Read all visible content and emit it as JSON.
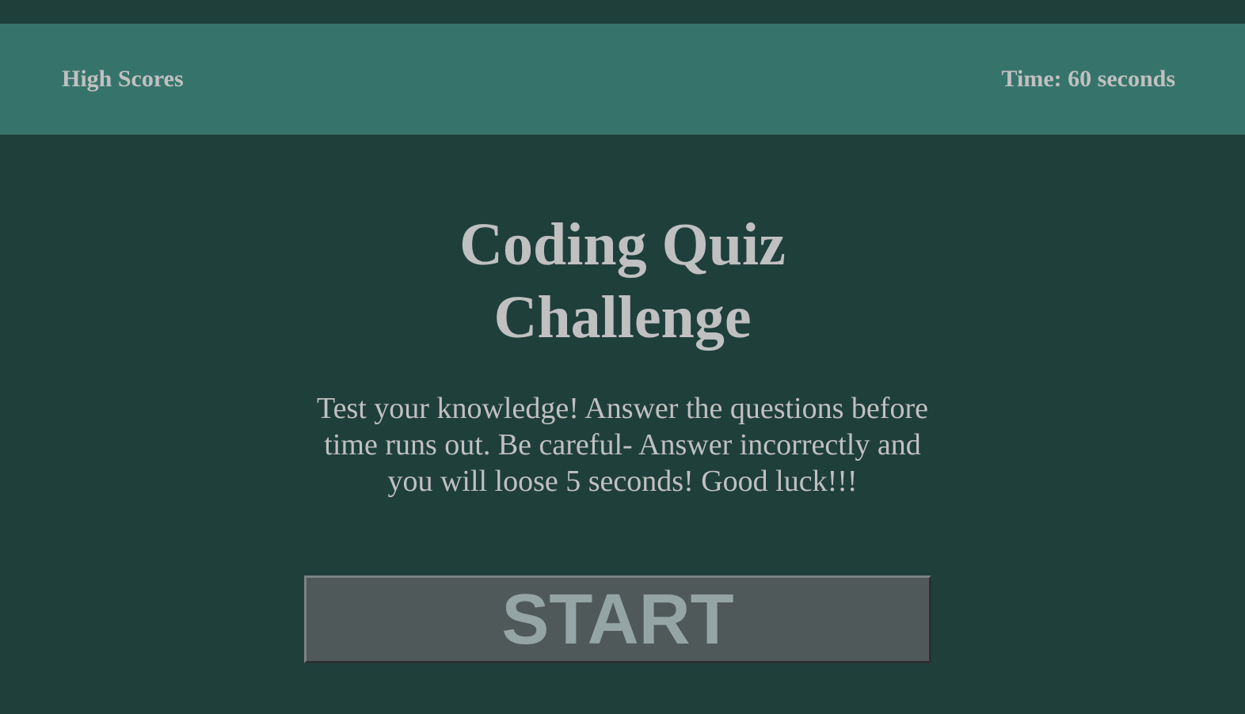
{
  "header": {
    "high_scores_label": "High Scores",
    "timer_label": "Time: 60 seconds"
  },
  "main": {
    "title": "Coding Quiz Challenge",
    "description": "Test your knowledge! Answer the questions before time runs out. Be careful- Answer incorrectly and you will loose 5 seconds! Good luck!!!",
    "start_label": "START"
  },
  "colors": {
    "page_background": "#1f3f3b",
    "header_background": "#36746b",
    "text": "#c0c0c0",
    "button_background": "#505959",
    "button_text": "#95a5a5"
  }
}
